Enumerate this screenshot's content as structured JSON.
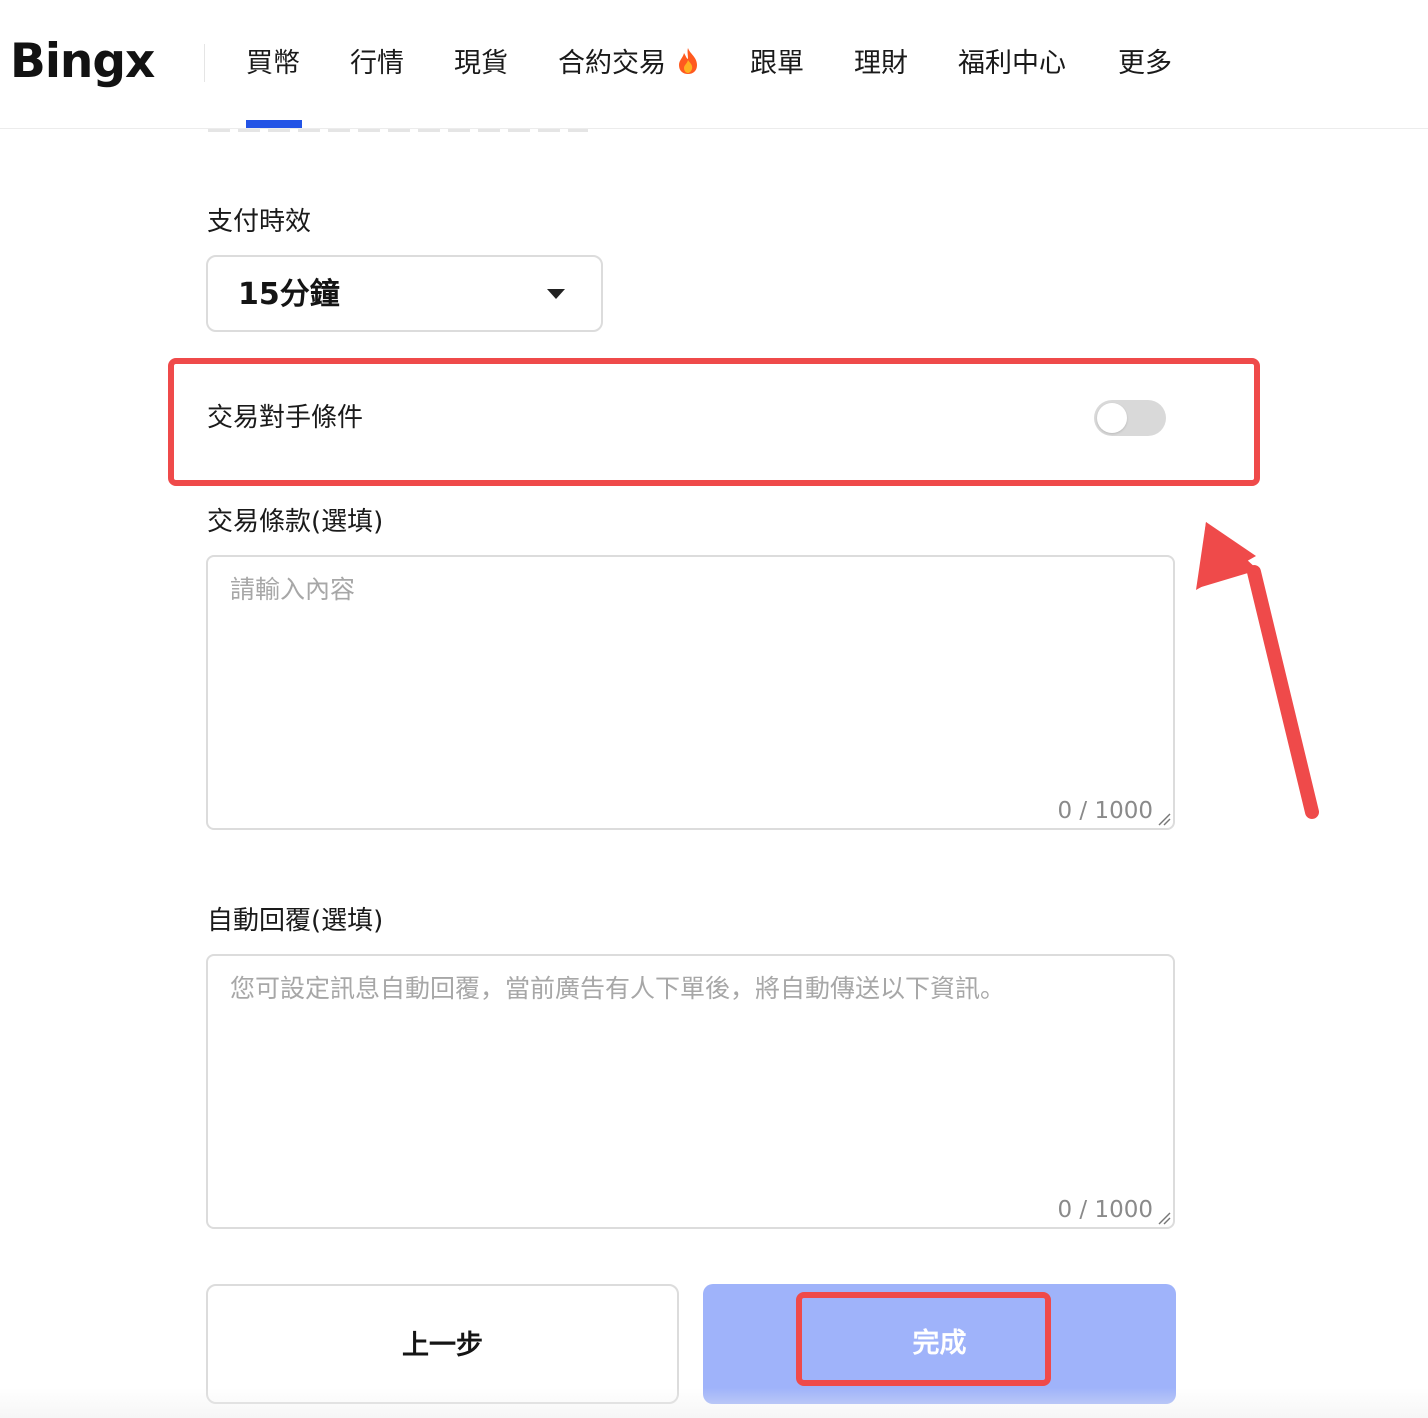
{
  "brand": {
    "logo_text": "Bingx"
  },
  "nav": {
    "items": [
      {
        "label": "買幣",
        "active": true
      },
      {
        "label": "行情"
      },
      {
        "label": "現貨"
      },
      {
        "label": "合約交易",
        "badge_icon": "fire-icon"
      },
      {
        "label": "跟單"
      },
      {
        "label": "理財"
      },
      {
        "label": "福利中心"
      },
      {
        "label": "更多"
      }
    ],
    "active_color": "#2354e6"
  },
  "form": {
    "payment_time": {
      "label": "支付時效",
      "value": "15分鐘"
    },
    "counterparty": {
      "label": "交易對手條件",
      "enabled": false
    },
    "terms": {
      "label": "交易條款(選填)",
      "placeholder": "請輸入內容",
      "counter": "0 / 1000"
    },
    "auto_reply": {
      "label": "自動回覆(選填)",
      "placeholder": "您可設定訊息自動回覆，當前廣告有人下單後，將自動傳送以下資訊。",
      "counter": "0 / 1000"
    }
  },
  "actions": {
    "prev_label": "上一步",
    "done_label": "完成"
  },
  "annotation": {
    "highlight_color": "#ef4a4a"
  }
}
